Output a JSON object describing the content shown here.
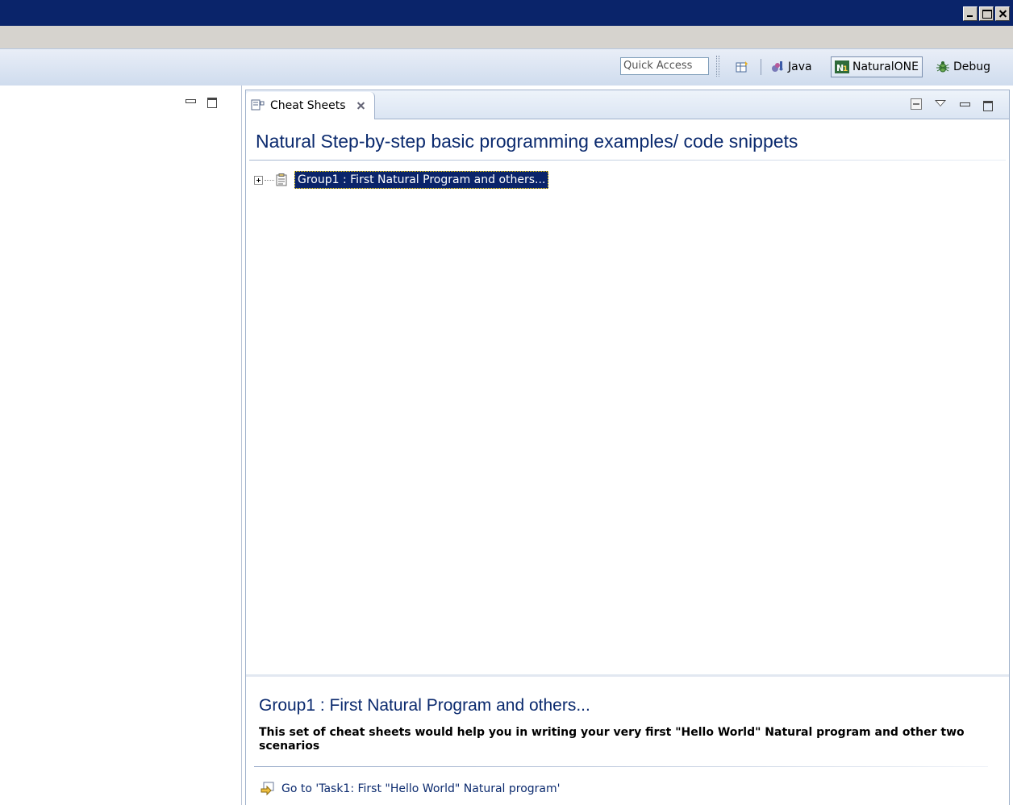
{
  "window": {
    "controls": [
      "minimize",
      "maximize",
      "close"
    ]
  },
  "toolbar": {
    "quick_access_placeholder": "Quick Access",
    "perspectives": {
      "java": "Java",
      "natural": "NaturalONE",
      "debug": "Debug"
    }
  },
  "view": {
    "tab_label": "Cheat Sheets",
    "sheet_title": "Natural Step-by-step basic programming examples/ code snippets",
    "tree": [
      {
        "label": "Group1 : First Natural Program and others...",
        "selected": true,
        "icon": "clipboard-icon"
      }
    ],
    "description": {
      "title": "Group1 : First Natural Program and others...",
      "text": "This set of cheat sheets would help you in writing your very first \"Hello World\" Natural program and other two scenarios",
      "goto_label": "Go to 'Task1: First \"Hello World\" Natural program'"
    }
  },
  "colors": {
    "titlebar": "#0a246a",
    "selection": "#0a246a",
    "heading": "#0b2a6e"
  }
}
